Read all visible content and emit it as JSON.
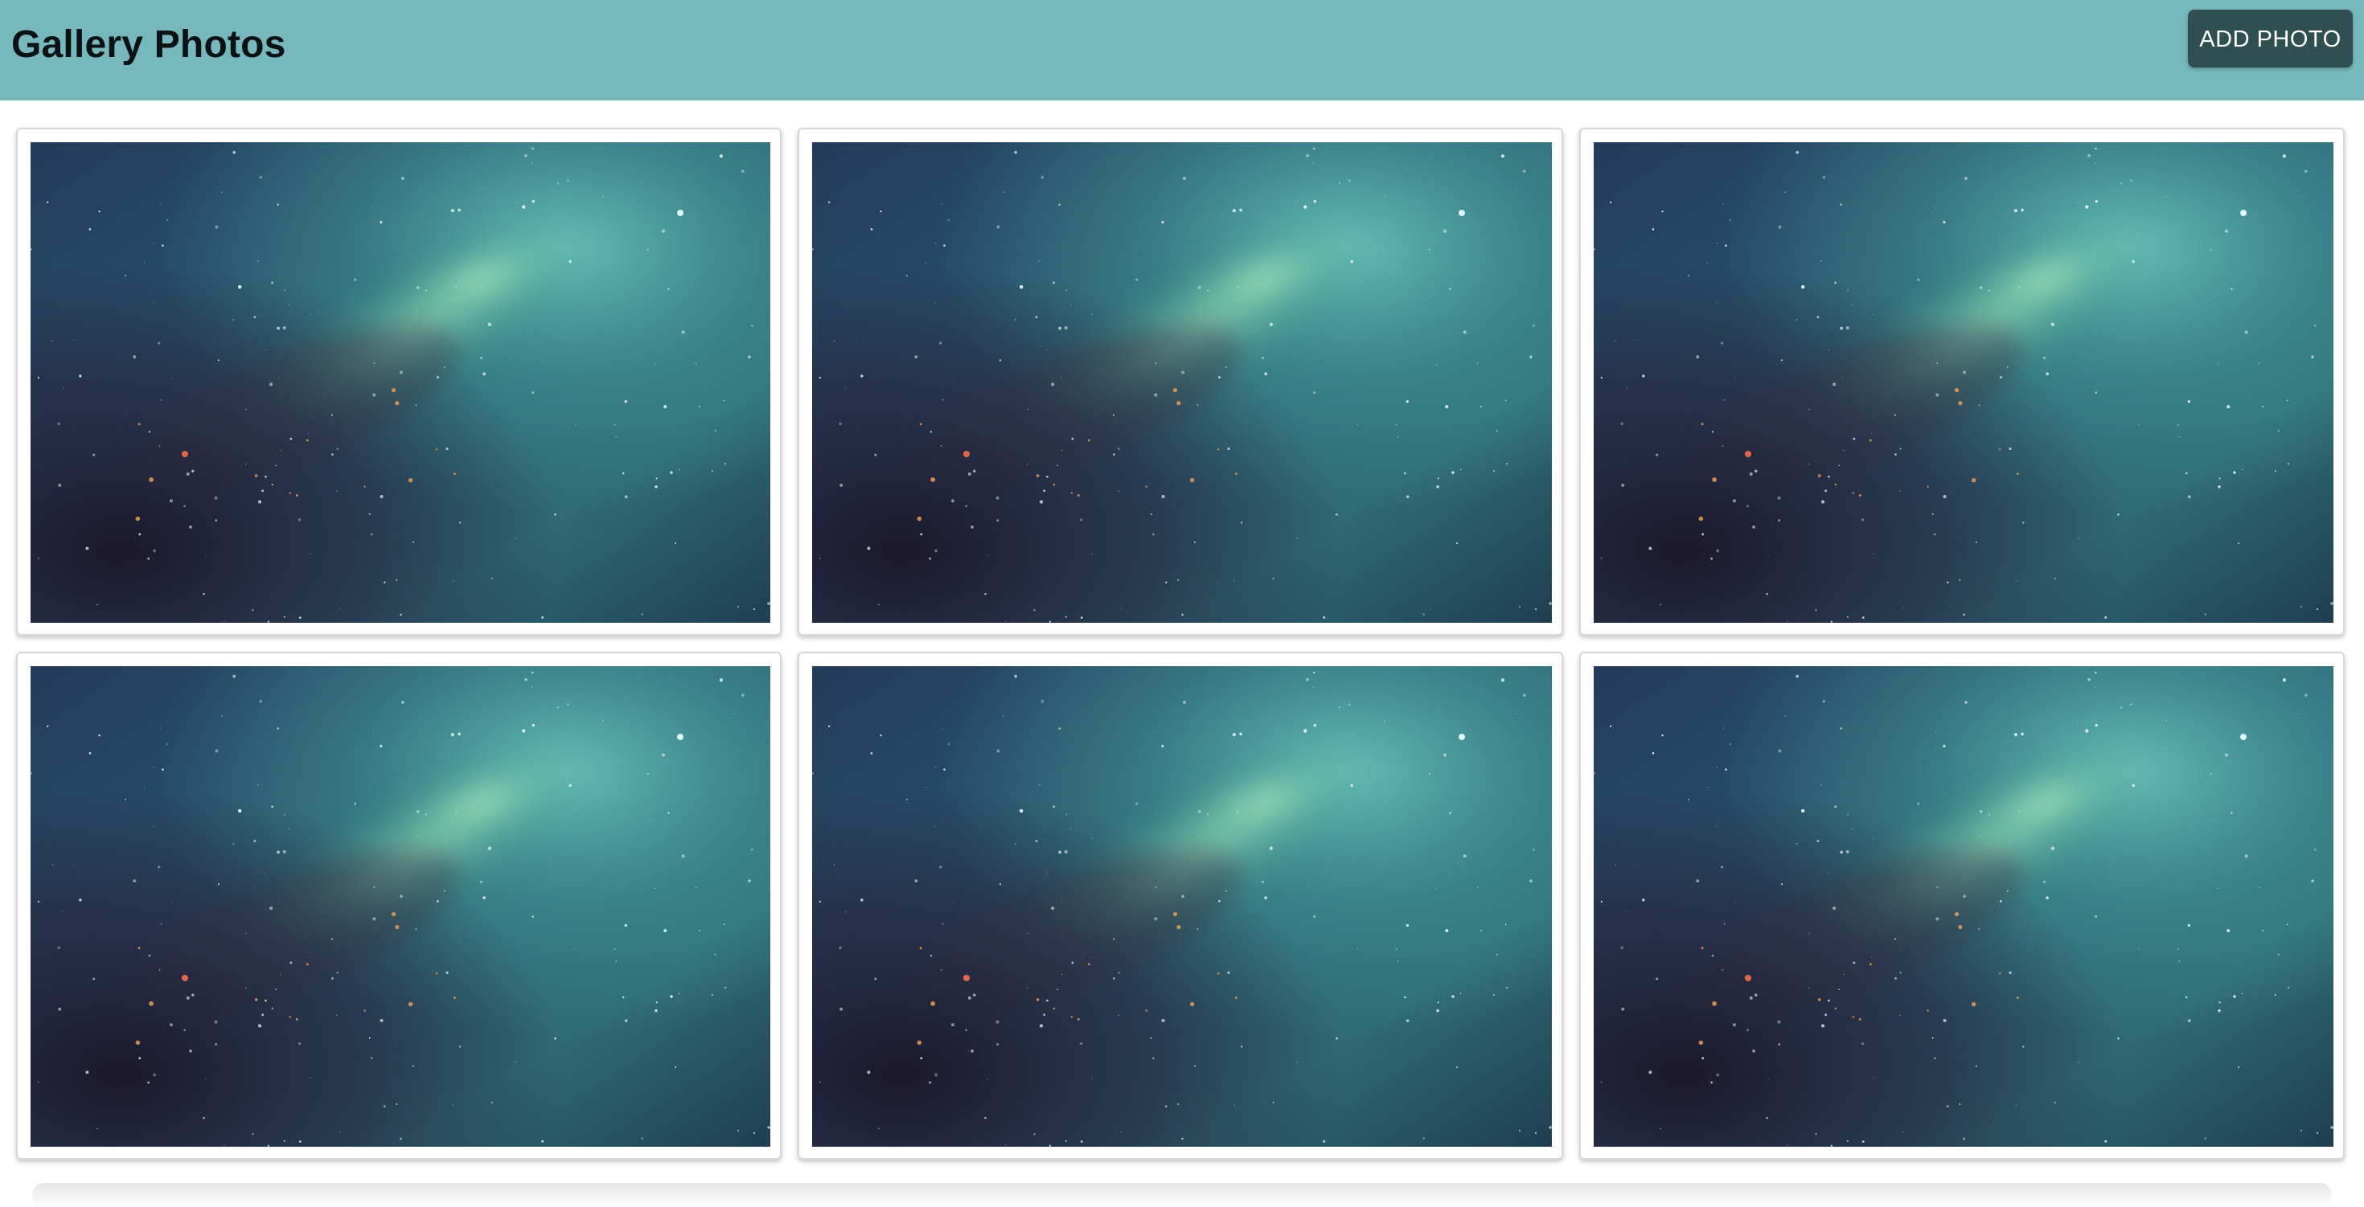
{
  "header": {
    "title": "Gallery Photos",
    "add_button_label": "ADD PHOTO",
    "background_color": "#76b8bc",
    "button_color": "#2f4f50"
  },
  "gallery": {
    "photos": [
      {
        "subject": "teal-nebula-space-image"
      },
      {
        "subject": "teal-nebula-space-image"
      },
      {
        "subject": "teal-nebula-space-image"
      },
      {
        "subject": "teal-nebula-space-image"
      },
      {
        "subject": "teal-nebula-space-image"
      },
      {
        "subject": "teal-nebula-space-image"
      }
    ]
  }
}
